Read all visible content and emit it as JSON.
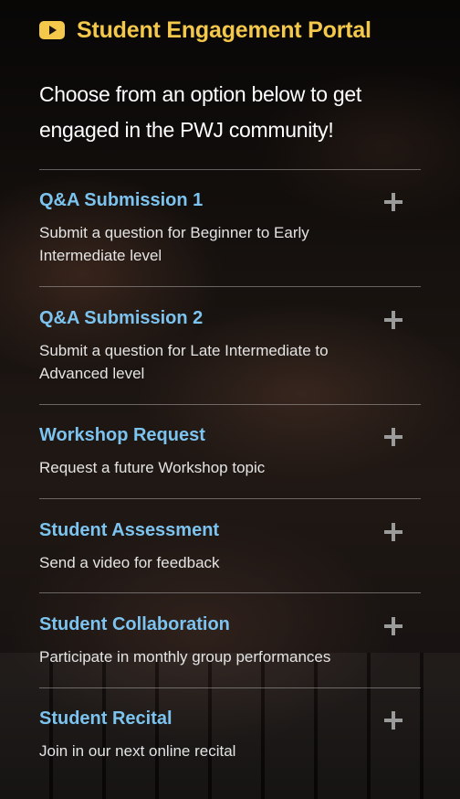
{
  "header": {
    "icon": "youtube-play-icon",
    "title": "Student Engagement Portal",
    "accent_color": "#f3c84b"
  },
  "intro": "Choose from an option below to get engaged in the PWJ community!",
  "accordion": {
    "title_color": "#7cc4ef",
    "expand_icon": "plus-icon",
    "items": [
      {
        "title": "Q&A Submission 1",
        "description": "Submit a question for Beginner to Early Intermediate level"
      },
      {
        "title": "Q&A Submission 2",
        "description": "Submit a question for Late Intermediate to Advanced level"
      },
      {
        "title": "Workshop Request",
        "description": "Request a future Workshop topic"
      },
      {
        "title": "Student Assessment",
        "description": "Send a video for feedback"
      },
      {
        "title": "Student Collaboration",
        "description": "Participate in monthly group performances"
      },
      {
        "title": "Student Recital",
        "description": "Join in our next online recital"
      }
    ]
  }
}
